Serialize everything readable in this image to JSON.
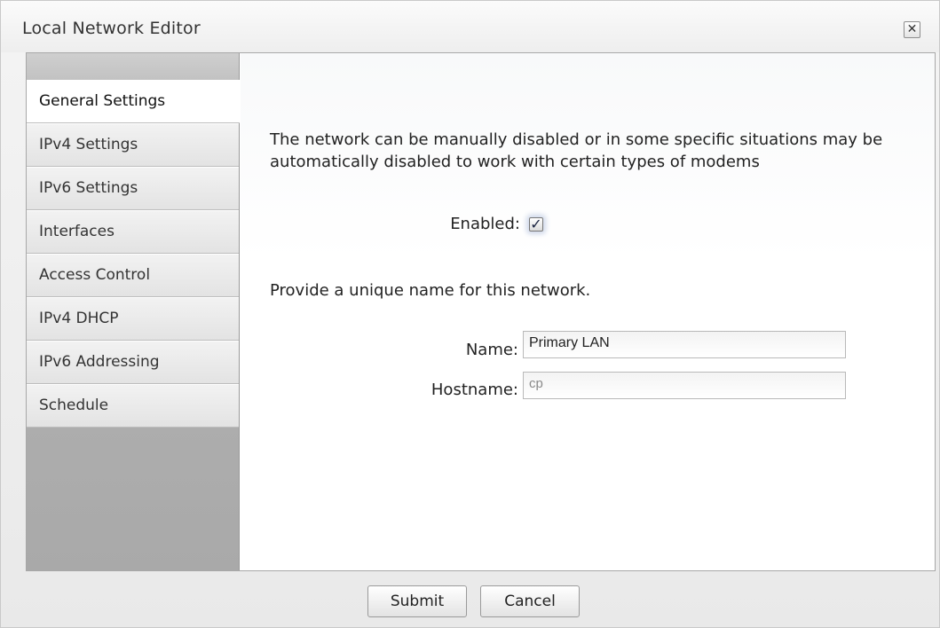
{
  "window": {
    "title": "Local Network Editor",
    "close_glyph": "✕"
  },
  "sidebar": {
    "items": [
      {
        "label": "General Settings",
        "active": true
      },
      {
        "label": "IPv4 Settings",
        "active": false
      },
      {
        "label": "IPv6 Settings",
        "active": false
      },
      {
        "label": "Interfaces",
        "active": false
      },
      {
        "label": "Access Control",
        "active": false
      },
      {
        "label": "IPv4 DHCP",
        "active": false
      },
      {
        "label": "IPv6 Addressing",
        "active": false
      },
      {
        "label": "Schedule",
        "active": false
      }
    ]
  },
  "main": {
    "description": "The network can be manually disabled or in some specific situations may be automatically disabled to work with certain types of modems",
    "enabled_label": "Enabled:",
    "enabled_checked": true,
    "enabled_glyph": "✓",
    "name_prompt": "Provide a unique name for this network.",
    "name_label": "Name:",
    "name_value": "Primary LAN",
    "hostname_label": "Hostname:",
    "hostname_placeholder": "cp"
  },
  "footer": {
    "submit_label": "Submit",
    "cancel_label": "Cancel"
  },
  "colors": {
    "focus_glow": "#cfd8ea",
    "active_tab": "#ffffff",
    "sidebar_bg": "#b0b0b0"
  },
  "icons": {
    "close": "close-icon",
    "checkbox": "checkmark-icon"
  }
}
